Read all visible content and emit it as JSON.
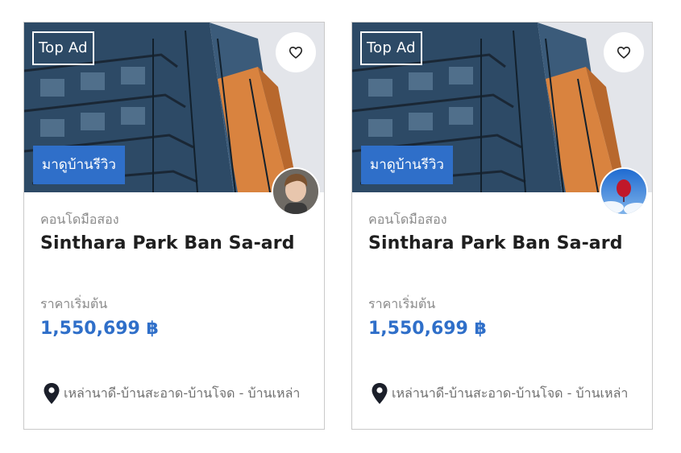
{
  "listings": [
    {
      "badge": "Top Ad",
      "favorite_icon": "heart-outline-icon",
      "review_tag": "มาดูบ้านรีวิว",
      "avatar": "person-portrait",
      "category": "คอนโดมือสอง",
      "title": "Sinthara Park Ban Sa-ard",
      "price_label": "ราคาเริ่มต้น",
      "price": "1,550,699 ฿",
      "location_icon": "map-pin-icon",
      "location": "เหล่านาดี-บ้านสะอาด-บ้านโจด - บ้านเหล่า"
    },
    {
      "badge": "Top Ad",
      "favorite_icon": "heart-outline-icon",
      "review_tag": "มาดูบ้านรีวิว",
      "avatar": "red-balloon-sky",
      "category": "คอนโดมือสอง",
      "title": "Sinthara Park Ban Sa-ard",
      "price_label": "ราคาเริ่มต้น",
      "price": "1,550,699 ฿",
      "location_icon": "map-pin-icon",
      "location": "เหล่านาดี-บ้านสะอาด-บ้านโจด - บ้านเหล่า"
    }
  ],
  "colors": {
    "accent": "#2f6fc9",
    "title": "#1f1f1f",
    "muted": "#8a8a8a",
    "card_border": "#c9c9c9"
  }
}
